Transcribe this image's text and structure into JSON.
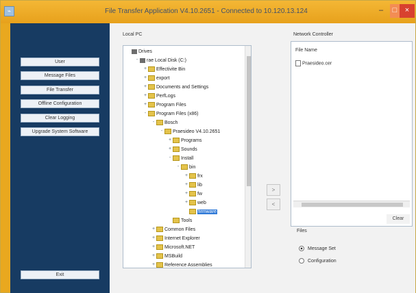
{
  "window": {
    "title": "File Transfer Application V4.10.2651 - Connected to 10.120.13.124",
    "accent": "#e9a81f"
  },
  "sidebar": {
    "items": [
      {
        "label": "User"
      },
      {
        "label": "Message Files"
      },
      {
        "label": "File Transfer"
      },
      {
        "label": "Offline Configuration"
      },
      {
        "label": "Clear Logging"
      },
      {
        "label": "Upgrade System Software"
      }
    ],
    "exit_label": "Exit"
  },
  "local": {
    "label": "Local PC",
    "tree": [
      {
        "label": "Drives",
        "level": 0,
        "icon": "drive",
        "toggle": ""
      },
      {
        "label": "rae Local Disk (C:)",
        "level": 1,
        "icon": "drive",
        "toggle": "-"
      },
      {
        "label": "Effectivite Bin",
        "level": 2,
        "icon": "folder",
        "toggle": "+"
      },
      {
        "label": "export",
        "level": 2,
        "icon": "folder",
        "toggle": "+"
      },
      {
        "label": "Documents and Settings",
        "level": 2,
        "icon": "folder",
        "toggle": "+"
      },
      {
        "label": "PerfLogs",
        "level": 2,
        "icon": "folder",
        "toggle": "+"
      },
      {
        "label": "Program Files",
        "level": 2,
        "icon": "folder",
        "toggle": "+"
      },
      {
        "label": "Program Files (x86)",
        "level": 2,
        "icon": "folder",
        "toggle": "-"
      },
      {
        "label": "Bosch",
        "level": 3,
        "icon": "folder",
        "toggle": "-"
      },
      {
        "label": "Praesideo V4.10.2651",
        "level": 4,
        "icon": "folder",
        "toggle": "-"
      },
      {
        "label": "Programs",
        "level": 5,
        "icon": "folder",
        "toggle": "+"
      },
      {
        "label": "Sounds",
        "level": 5,
        "icon": "folder",
        "toggle": "+"
      },
      {
        "label": "Install",
        "level": 5,
        "icon": "folder",
        "toggle": "-"
      },
      {
        "label": "bin",
        "level": 6,
        "icon": "folder",
        "toggle": "-"
      },
      {
        "label": "frx",
        "level": 7,
        "icon": "folder",
        "toggle": "+"
      },
      {
        "label": "lib",
        "level": 7,
        "icon": "folder",
        "toggle": "+"
      },
      {
        "label": "fw",
        "level": 7,
        "icon": "folder",
        "toggle": "+"
      },
      {
        "label": "web",
        "level": 7,
        "icon": "folder",
        "toggle": "+"
      },
      {
        "label": "firmware",
        "level": 7,
        "icon": "folder",
        "toggle": "",
        "selected": true
      },
      {
        "label": "Tools",
        "level": 5,
        "icon": "folder",
        "toggle": ""
      },
      {
        "label": "Common Files",
        "level": 3,
        "icon": "folder",
        "toggle": "+"
      },
      {
        "label": "Internet Explorer",
        "level": 3,
        "icon": "folder",
        "toggle": "+"
      },
      {
        "label": "Microsoft.NET",
        "level": 3,
        "icon": "folder",
        "toggle": "+"
      },
      {
        "label": "MSBuild",
        "level": 3,
        "icon": "folder",
        "toggle": "+"
      },
      {
        "label": "Reference Assemblies",
        "level": 3,
        "icon": "folder",
        "toggle": "+"
      }
    ]
  },
  "network": {
    "label": "Network Controller",
    "header": "File Name",
    "files": [
      {
        "name": "Praesideo.cer"
      }
    ],
    "clear_label": "Clear"
  },
  "transfer": {
    "to_network": ">",
    "to_local": "<"
  },
  "files": {
    "label": "Files",
    "options": [
      {
        "label": "Message Set",
        "checked": true
      },
      {
        "label": "Configuration",
        "checked": false
      }
    ]
  }
}
